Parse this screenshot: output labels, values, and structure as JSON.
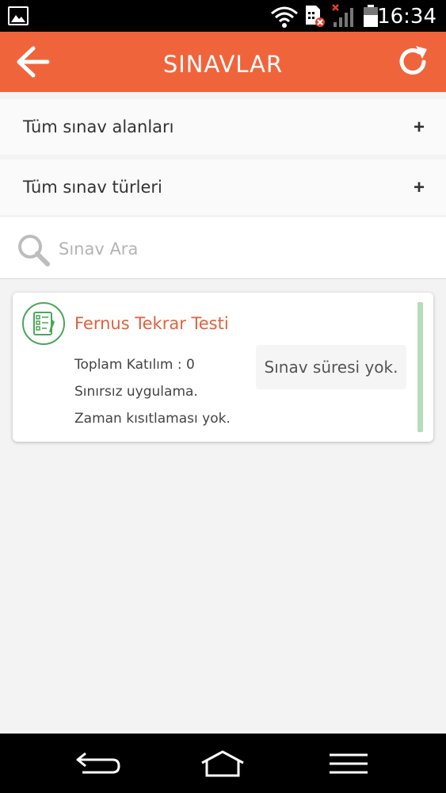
{
  "status_bar": {
    "time": "16:34",
    "icons": [
      "gallery-icon",
      "wifi-icon",
      "sim-error-icon",
      "signal-off-icon",
      "battery-icon"
    ]
  },
  "app_bar": {
    "title": "SINAVLAR",
    "back_icon": "arrow-left-icon",
    "refresh_icon": "refresh-icon",
    "background": "#f0643c"
  },
  "filters": [
    {
      "label": "Tüm sınav alanları",
      "action": "+"
    },
    {
      "label": "Tüm sınav türleri",
      "action": "+"
    }
  ],
  "search": {
    "placeholder": "Sınav Ara",
    "value": ""
  },
  "exams": [
    {
      "title": "Fernus Tekrar Testi",
      "participation": "Toplam Katılım : 0",
      "usage": "Sınırsız uygulama.",
      "time_limit": "Zaman kısıtlaması yok.",
      "duration": "Sınav süresi yok.",
      "title_color": "#e2603b",
      "accent_color": "#b6ddb9"
    }
  ],
  "nav_bar": {
    "icons": [
      "back-nav-icon",
      "home-nav-icon",
      "menu-nav-icon"
    ]
  }
}
